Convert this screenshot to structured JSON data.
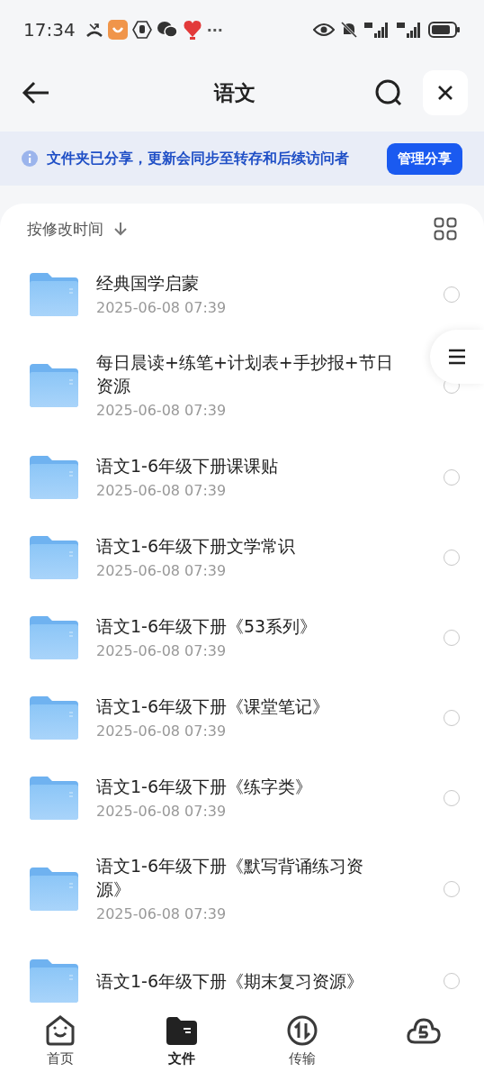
{
  "status_bar": {
    "time": "17:34",
    "more": "···"
  },
  "top_bar": {
    "title": "语文"
  },
  "banner": {
    "text": "文件夹已分享，更新会同步至转存和后续访问者",
    "button": "管理分享"
  },
  "sort": {
    "label": "按修改时间"
  },
  "files": [
    {
      "name": "经典国学启蒙",
      "date": "2025-06-08 07:39",
      "checked": false
    },
    {
      "name": "每日晨读+练笔+计划表+手抄报+节日资源",
      "date": "2025-06-08 07:39",
      "checked": false
    },
    {
      "name": "语文1-6年级下册课课贴",
      "date": "2025-06-08 07:39",
      "checked": false
    },
    {
      "name": "语文1-6年级下册文学常识",
      "date": "2025-06-08 07:39",
      "checked": false
    },
    {
      "name": "语文1-6年级下册《53系列》",
      "date": "2025-06-08 07:39",
      "checked": false
    },
    {
      "name": "语文1-6年级下册《课堂笔记》",
      "date": "2025-06-08 07:39",
      "checked": false
    },
    {
      "name": "语文1-6年级下册《练字类》",
      "date": "2025-06-08 07:39",
      "checked": false
    },
    {
      "name": "语文1-6年级下册《默写背诵练习资源》",
      "date": "2025-06-08 07:39",
      "checked": false
    },
    {
      "name": "语文1-6年级下册《期末复习资源》",
      "checked": false
    }
  ],
  "nav": [
    {
      "kind": "home",
      "label": "首页",
      "selected": false
    },
    {
      "kind": "files",
      "label": "文件",
      "selected": true
    },
    {
      "kind": "transfer",
      "label": "传输",
      "selected": false
    },
    {
      "kind": "cloud",
      "selected": false
    }
  ]
}
